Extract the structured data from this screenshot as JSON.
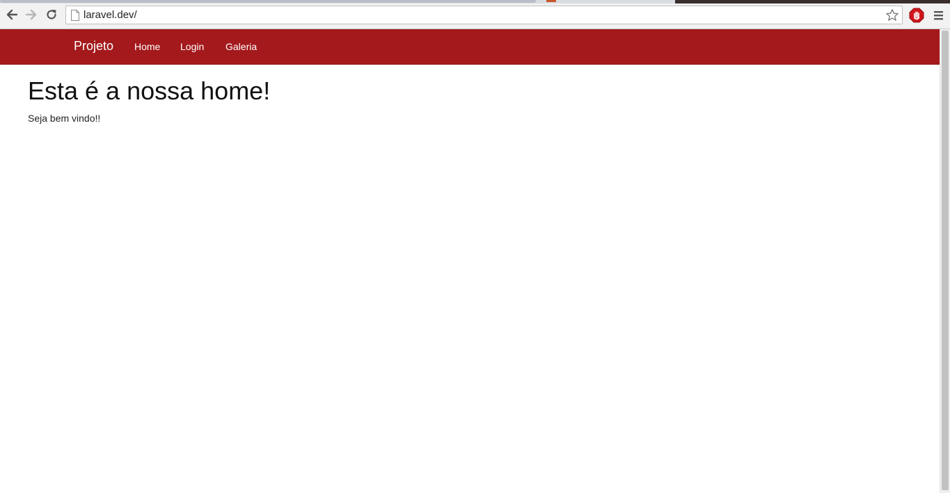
{
  "browser": {
    "url": "laravel.dev/"
  },
  "navbar": {
    "brand": "Projeto",
    "links": [
      {
        "label": "Home"
      },
      {
        "label": "Login"
      },
      {
        "label": "Galeria"
      }
    ],
    "background_color": "#a4191c"
  },
  "content": {
    "heading": "Esta é a nossa home!",
    "text": "Seja bem vindo!!"
  }
}
